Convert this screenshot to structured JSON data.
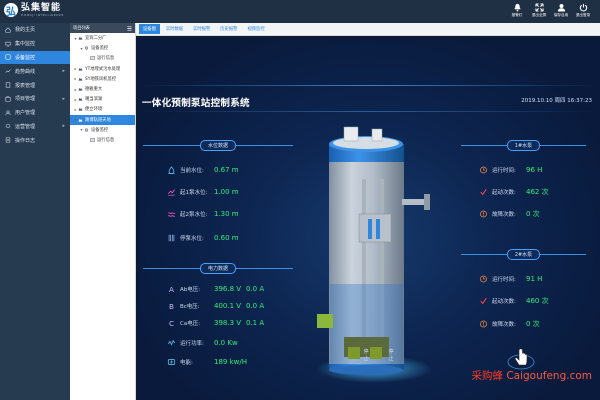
{
  "header": {
    "logo_char": "弘",
    "brand_cn": "弘集智能",
    "brand_en": "HONGJI INTELLIGENCE",
    "actions": [
      {
        "label": "报警灯",
        "icon": "bell-icon"
      },
      {
        "label": "退出全屏",
        "icon": "fullscreen-icon"
      },
      {
        "label": "保存自用",
        "icon": "user-icon"
      },
      {
        "label": "退出登录",
        "icon": "power-icon"
      }
    ]
  },
  "sidebar": {
    "items": [
      {
        "label": "我的主页",
        "icon": "home-icon"
      },
      {
        "label": "集中监控",
        "icon": "monitor-icon"
      },
      {
        "label": "设备监控",
        "icon": "device-icon"
      },
      {
        "label": "趋势曲线",
        "icon": "trend-icon"
      },
      {
        "label": "报表管理",
        "icon": "report-icon"
      },
      {
        "label": "项目管理",
        "icon": "project-icon"
      },
      {
        "label": "用户管理",
        "icon": "users-icon"
      },
      {
        "label": "运营管理",
        "icon": "operation-icon"
      },
      {
        "label": "操作日志",
        "icon": "log-icon"
      }
    ]
  },
  "tree": {
    "header": "项目列表",
    "nodes": [
      {
        "label": "宜宾二分厂",
        "level": 0,
        "toggle": "▾"
      },
      {
        "label": "设备监控",
        "level": 1,
        "toggle": "▾"
      },
      {
        "label": "运行信息",
        "level": 2,
        "toggle": ""
      },
      {
        "label": "YT地埋式污水处理",
        "level": 0,
        "toggle": "▸"
      },
      {
        "label": "SY地铁风机监控",
        "level": 0,
        "toggle": "▸"
      },
      {
        "label": "德雅重大",
        "level": 0,
        "toggle": "▸"
      },
      {
        "label": "噶当滨湖",
        "level": 0,
        "toggle": "▸"
      },
      {
        "label": "便立环境",
        "level": 0,
        "toggle": "▸"
      },
      {
        "label": "路博轨道天地",
        "level": 0,
        "toggle": "▾"
      },
      {
        "label": "设备监控",
        "level": 1,
        "toggle": "▾"
      },
      {
        "label": "运行信息",
        "level": 2,
        "toggle": ""
      }
    ]
  },
  "tabs": [
    "设备图",
    "实时数据",
    "实时报警",
    "历史报警",
    "视频监控"
  ],
  "screen": {
    "title": "一体化预制泵站控制系统",
    "datetime": "2019.10.10 周四 16:37:23",
    "water_section": "水位数据",
    "water_rows": [
      {
        "label": "当前水位:",
        "value": "0.67 m"
      },
      {
        "label": "起1泵水位:",
        "value": "1.00 m"
      },
      {
        "label": "起2泵水位:",
        "value": "1.30 m"
      },
      {
        "label": "停泵水位:",
        "value": "0.60 m"
      }
    ],
    "power_section": "电力数据",
    "power_rows": [
      {
        "label": "Ab电压:",
        "value": "396.8 V",
        "value2": "0.0 A",
        "icon_char": "A"
      },
      {
        "label": "Bc电压:",
        "value": "400.1 V",
        "value2": "0.0 A",
        "icon_char": "B"
      },
      {
        "label": "Ca电压:",
        "value": "398.3 V",
        "value2": "0.1 A",
        "icon_char": "C"
      },
      {
        "label": "运行功率:",
        "value": "0.0 Kw",
        "value2": "",
        "icon_char": ""
      },
      {
        "label": "电能:",
        "value": "189 kw/H",
        "value2": "",
        "icon_char": ""
      }
    ],
    "pump1": {
      "title": "1#水泵",
      "rows": [
        {
          "label": "运行时间:",
          "value": "96 H"
        },
        {
          "label": "起动次数:",
          "value": "462 次"
        },
        {
          "label": "故障次数:",
          "value": "0 次"
        }
      ]
    },
    "pump2": {
      "title": "2#水泵",
      "rows": [
        {
          "label": "运行时间:",
          "value": "91 H"
        },
        {
          "label": "起动次数:",
          "value": "460 次"
        },
        {
          "label": "故障次数:",
          "value": "0 次"
        }
      ]
    },
    "stop1": "停止",
    "stop2": "停止"
  },
  "watermark": {
    "cn": "采购蜂",
    "en": "Caigoufeng.com"
  },
  "colors": {
    "accent": "#2e86de",
    "value_green": "#2ef07a",
    "screen_bg": "#0d2550"
  }
}
